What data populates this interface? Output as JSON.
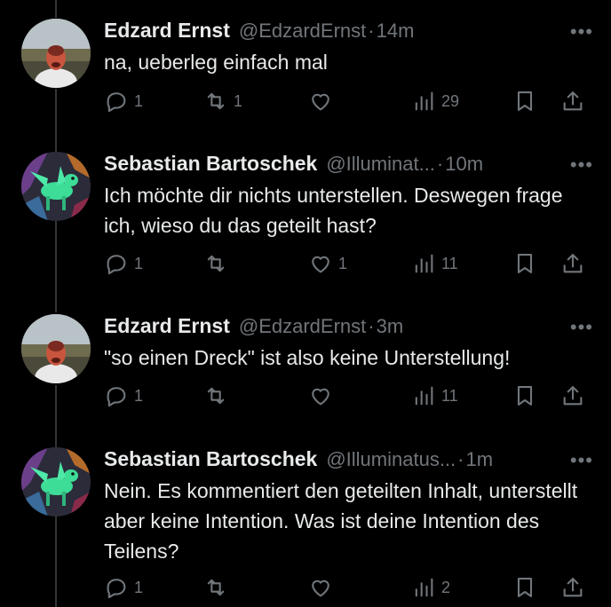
{
  "tweets": [
    {
      "name": "Edzard Ernst",
      "handle": "@EdzardErnst",
      "time": "14m",
      "text": "na, ueberleg einfach mal",
      "replies": "1",
      "retweets": "1",
      "likes": "",
      "views": "29"
    },
    {
      "name": "Sebastian Bartoschek",
      "handle": "@Illuminat...",
      "time": "10m",
      "text": "Ich möchte dir nichts unterstellen. Deswegen frage ich, wieso du das geteilt hast?",
      "replies": "1",
      "retweets": "",
      "likes": "1",
      "views": "11"
    },
    {
      "name": "Edzard Ernst",
      "handle": "@EdzardErnst",
      "time": "3m",
      "text": "\"so einen Dreck\" ist also keine Unterstellung!",
      "replies": "1",
      "retweets": "",
      "likes": "",
      "views": "11"
    },
    {
      "name": "Sebastian Bartoschek",
      "handle": "@Illuminatus...",
      "time": "1m",
      "text": "Nein. Es kommentiert den geteilten Inhalt, unterstellt aber keine Intention. Was ist deine Intention des Teilens?",
      "replies": "1",
      "retweets": "",
      "likes": "",
      "views": "2"
    }
  ],
  "icons": {
    "more": "more-icon",
    "reply": "reply-icon",
    "retweet": "retweet-icon",
    "like": "heart-icon",
    "views": "views-icon",
    "bookmark": "bookmark-icon",
    "share": "share-icon"
  },
  "colors": {
    "background": "#000000",
    "text": "#e7e9ea",
    "muted": "#71767b",
    "thread_line": "#333639"
  }
}
